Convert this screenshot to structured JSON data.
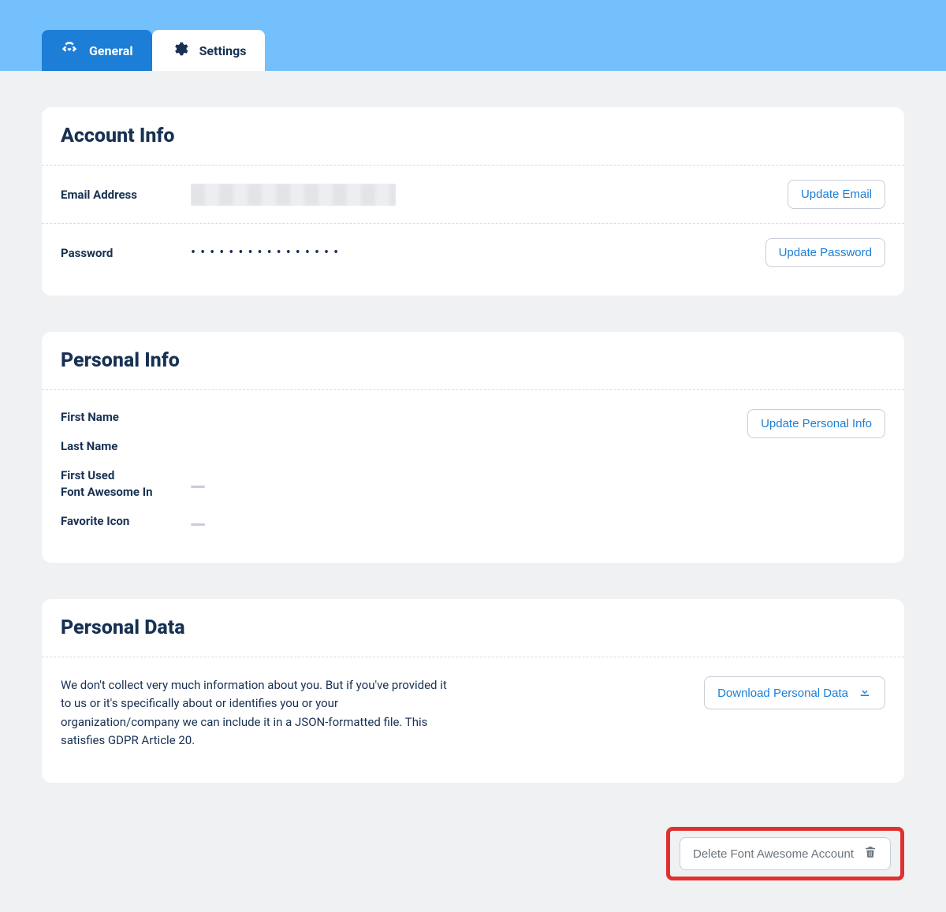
{
  "tabs": {
    "general": "General",
    "settings": "Settings"
  },
  "account_info": {
    "title": "Account Info",
    "email_label": "Email Address",
    "password_label": "Password",
    "password_masked": "••••••••••••••••",
    "update_email": "Update Email",
    "update_password": "Update Password"
  },
  "personal_info": {
    "title": "Personal Info",
    "first_name_label": "First Name",
    "last_name_label": "Last Name",
    "first_used_label": "First Used\nFont Awesome In",
    "favorite_icon_label": "Favorite Icon",
    "update_button": "Update Personal Info"
  },
  "personal_data": {
    "title": "Personal Data",
    "description": "We don't collect very much information about you. But if you've provided it to us or it's specifically about or identifies you or your organization/company we can include it in a JSON-formatted file. This satisfies GDPR Article 20.",
    "download_button": "Download Personal Data"
  },
  "delete_account": {
    "label": "Delete Font Awesome Account"
  }
}
